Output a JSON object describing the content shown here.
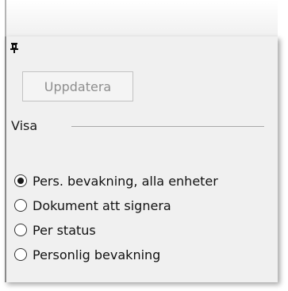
{
  "toolbar": {
    "pin_icon": "pushpin-icon",
    "update_label": "Uppdatera"
  },
  "view_group": {
    "label": "Visa",
    "options": [
      {
        "label": "Pers. bevakning, alla enheter",
        "selected": true
      },
      {
        "label": "Dokument att signera",
        "selected": false
      },
      {
        "label": "Per status",
        "selected": false
      },
      {
        "label": "Personlig bevakning",
        "selected": false
      }
    ]
  },
  "colors": {
    "panel_background": "#f0f0f0",
    "button_text_disabled": "#8e8e8e",
    "separator": "#a8a8a8"
  }
}
